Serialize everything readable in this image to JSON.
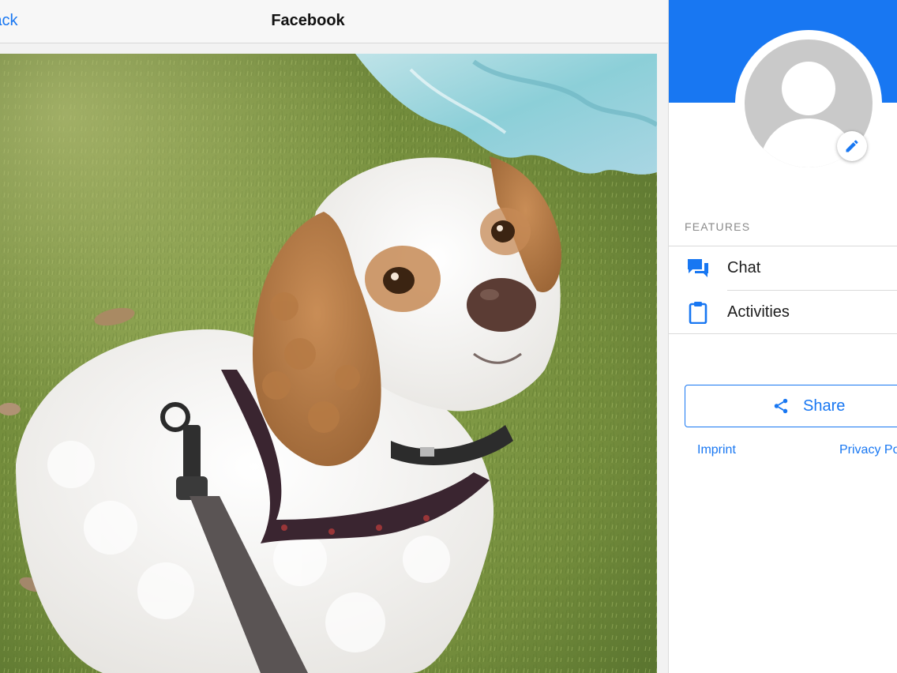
{
  "nav": {
    "back_label": "Back",
    "title": "Facebook"
  },
  "photo": {
    "subject": "dog-photo"
  },
  "profile": {
    "avatar_icon": "user-placeholder-icon",
    "edit_icon": "pencil-icon"
  },
  "features": {
    "heading": "FEATURES",
    "items": [
      {
        "label": "Chat",
        "icon": "chat-bubbles-icon"
      },
      {
        "label": "Activities",
        "icon": "clipboard-icon"
      }
    ]
  },
  "share": {
    "label": "Share",
    "icon": "share-icon"
  },
  "footer": {
    "links": [
      "Imprint",
      "Privacy Policy"
    ]
  },
  "colors": {
    "accent": "#1877f2",
    "cover": "#1877f2",
    "avatar_bg": "#c9c9c9"
  }
}
